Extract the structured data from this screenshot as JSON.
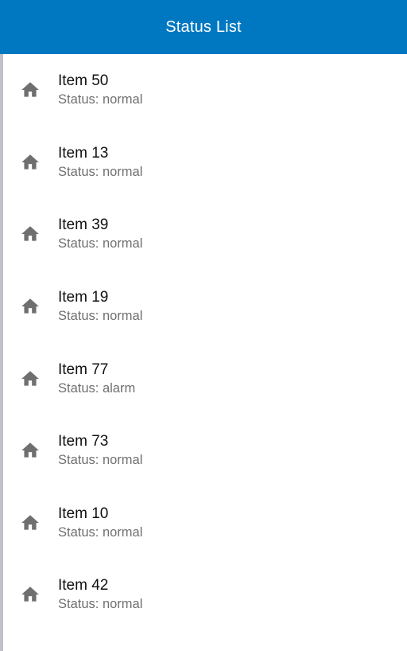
{
  "header": {
    "title": "Status List"
  },
  "colors": {
    "app_bar": "#0078c1",
    "icon": "#6f6f6f",
    "title_text": "#111111",
    "status_text": "#6f6f6f",
    "left_rail": "#c1c1cb"
  },
  "list": {
    "items": [
      {
        "icon": "home-icon",
        "title": "Item 50",
        "status": "Status: normal"
      },
      {
        "icon": "home-icon",
        "title": "Item 13",
        "status": "Status: normal"
      },
      {
        "icon": "home-icon",
        "title": "Item 39",
        "status": "Status: normal"
      },
      {
        "icon": "home-icon",
        "title": "Item 19",
        "status": "Status: normal"
      },
      {
        "icon": "home-icon",
        "title": "Item 77",
        "status": "Status: alarm"
      },
      {
        "icon": "home-icon",
        "title": "Item 73",
        "status": "Status: normal"
      },
      {
        "icon": "home-icon",
        "title": "Item 10",
        "status": "Status: normal"
      },
      {
        "icon": "home-icon",
        "title": "Item 42",
        "status": "Status: normal"
      }
    ]
  }
}
